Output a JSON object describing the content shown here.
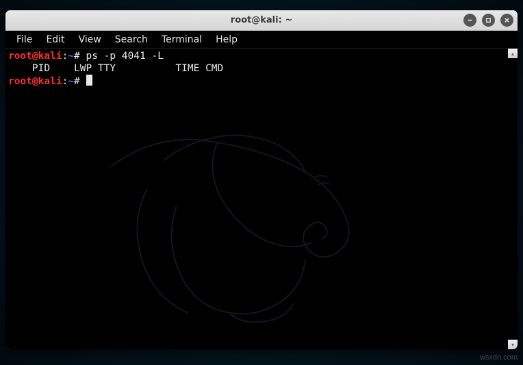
{
  "window": {
    "title": "root@kali: ~"
  },
  "menubar": {
    "items": [
      "File",
      "Edit",
      "View",
      "Search",
      "Terminal",
      "Help"
    ]
  },
  "prompt": {
    "user": "root",
    "at": "@",
    "host": "kali",
    "sep1": ":",
    "path": "~",
    "symbol": "#"
  },
  "lines": {
    "cmd1": "ps -p 4041 -L",
    "header": "    PID    LWP TTY          TIME CMD"
  },
  "watermark": "wsxdn.com"
}
